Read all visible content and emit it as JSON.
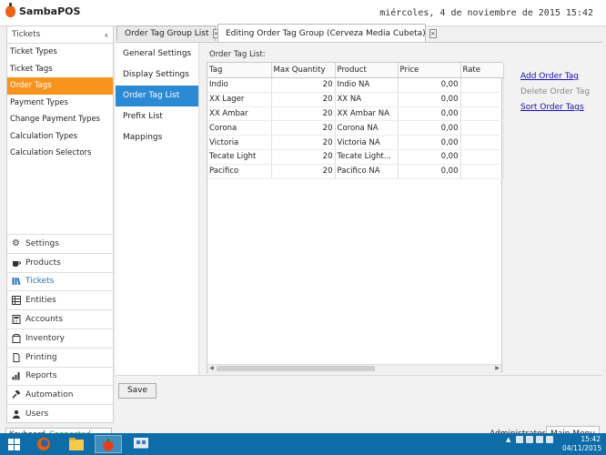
{
  "app": {
    "title": "SambaPOS"
  },
  "header": {
    "datetime": "miércoles, 4 de noviembre de 2015 15:42"
  },
  "left_panel": {
    "heading": "Tickets",
    "collapse_glyph": "‹",
    "items": [
      {
        "label": "Ticket Types",
        "selected": false
      },
      {
        "label": "Ticket Tags",
        "selected": false
      },
      {
        "label": "Order Tags",
        "selected": true
      },
      {
        "label": "Payment Types",
        "selected": false
      },
      {
        "label": "Change Payment Types",
        "selected": false
      },
      {
        "label": "Calculation Types",
        "selected": false
      },
      {
        "label": "Calculation Selectors",
        "selected": false
      }
    ]
  },
  "nav": [
    {
      "label": "Settings",
      "icon": "gear-icon"
    },
    {
      "label": "Products",
      "icon": "coffee-cup-icon"
    },
    {
      "label": "Tickets",
      "icon": "books-icon",
      "active": true
    },
    {
      "label": "Entities",
      "icon": "grid-list-icon"
    },
    {
      "label": "Accounts",
      "icon": "calculator-icon"
    },
    {
      "label": "Inventory",
      "icon": "box-icon"
    },
    {
      "label": "Printing",
      "icon": "document-icon"
    },
    {
      "label": "Reports",
      "icon": "bar-chart-icon"
    },
    {
      "label": "Automation",
      "icon": "hammer-icon"
    },
    {
      "label": "Users",
      "icon": "user-icon"
    }
  ],
  "tabs": [
    {
      "label": "Order Tag Group List",
      "close": "×",
      "active": false
    },
    {
      "label": "Editing Order Tag Group (Cerveza Media Cubeta)",
      "close": "×",
      "active": true
    }
  ],
  "editor": {
    "sections": [
      {
        "label": "General Settings",
        "selected": false
      },
      {
        "label": "Display Settings",
        "selected": false
      },
      {
        "label": "Order Tag List",
        "selected": true
      },
      {
        "label": "Prefix List",
        "selected": false
      },
      {
        "label": "Mappings",
        "selected": false
      }
    ],
    "list_label": "Order Tag List:",
    "columns": [
      "Tag",
      "Max Quantity",
      "Product",
      "Price",
      "Rate"
    ],
    "rows": [
      [
        "Indio",
        "20",
        "Indio NA",
        "0,00",
        ""
      ],
      [
        "XX Lager",
        "20",
        "XX NA",
        "0,00",
        ""
      ],
      [
        "XX Ambar",
        "20",
        "XX Ambar NA",
        "0,00",
        ""
      ],
      [
        "Corona",
        "20",
        "Corona NA",
        "0,00",
        ""
      ],
      [
        "Victoria",
        "20",
        "Victoria NA",
        "0,00",
        ""
      ],
      [
        "Tecate Light",
        "20",
        "Tecate Light...",
        "0,00",
        ""
      ],
      [
        "Pacifico",
        "20",
        "Pacifico NA",
        "0,00",
        ""
      ]
    ],
    "actions": [
      {
        "label": "Add Order Tag",
        "enabled": true
      },
      {
        "label": "Delete Order Tag",
        "enabled": false
      },
      {
        "label": "Sort Order Tags",
        "enabled": true
      }
    ],
    "save_label": "Save"
  },
  "status": {
    "keyboard_label": "Keyboard",
    "connection": "Connected",
    "user": "Administrator",
    "main_menu": "Main Menu"
  },
  "taskbar": {
    "clock_time": "15:42",
    "clock_date": "04/11/2015",
    "apps": [
      "windows-start-icon",
      "firefox-icon",
      "file-explorer-icon",
      "sambapos-icon",
      "network-app-icon"
    ]
  },
  "colors": {
    "accent_orange": "#f7941d",
    "selection_blue": "#2b8ad4",
    "taskbar": "#0e6ca8",
    "connected_green": "#2e9b2e"
  }
}
